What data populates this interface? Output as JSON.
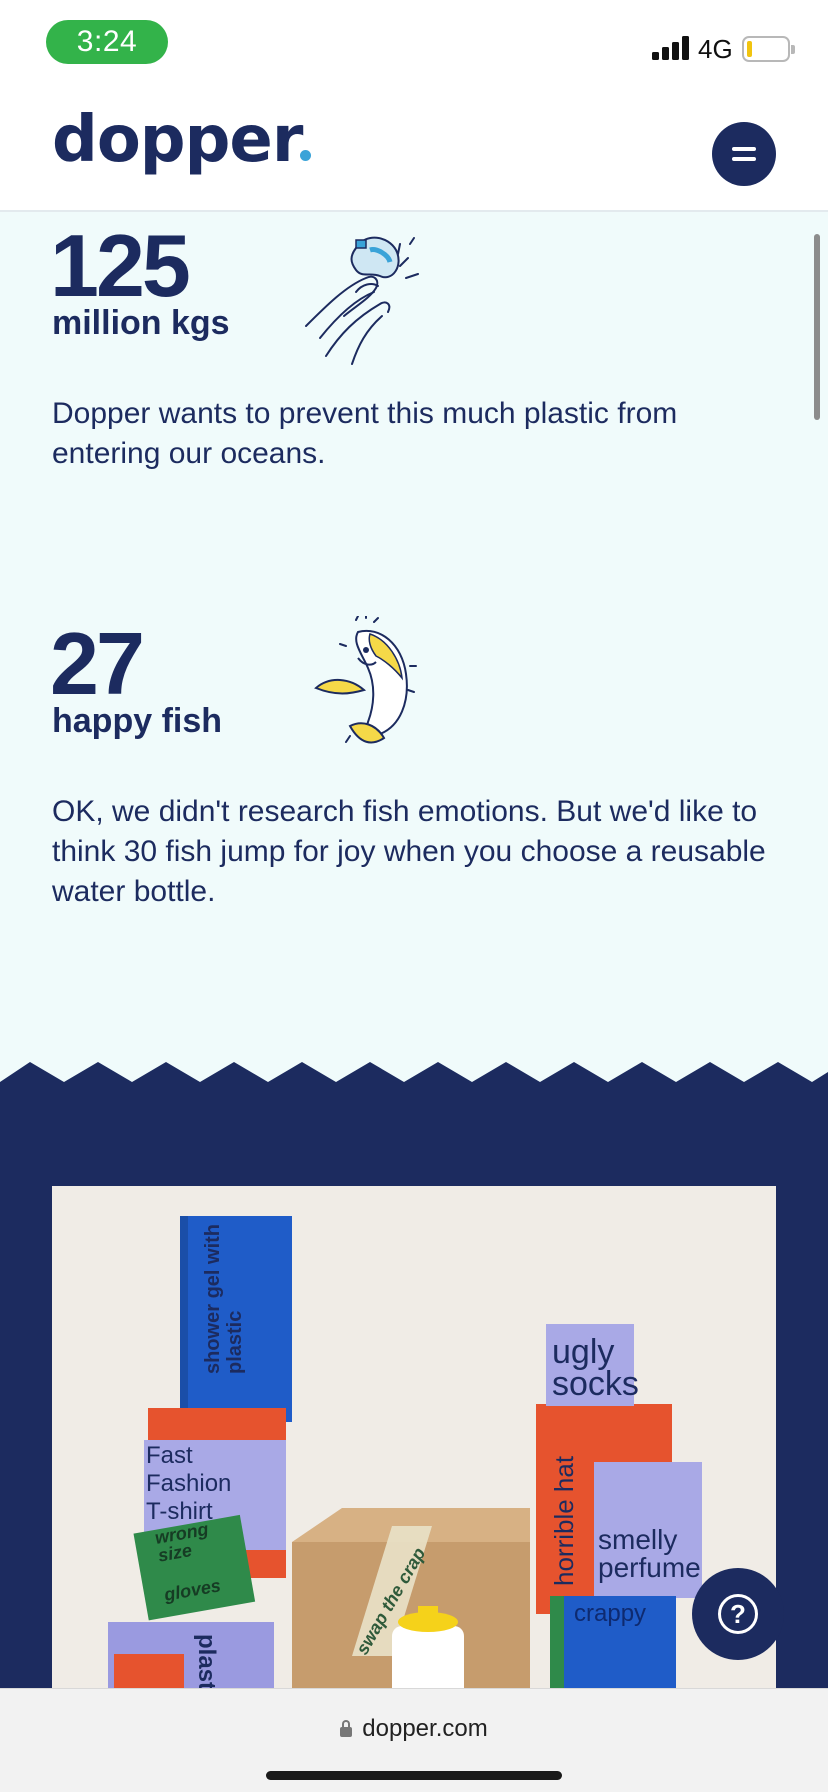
{
  "status_bar": {
    "time": "3:24",
    "network": "4G"
  },
  "header": {
    "logo_text": "dopper"
  },
  "stats": [
    {
      "number": "125",
      "unit": "million kgs",
      "text": "Dopper wants to prevent this much plastic from entering our oceans."
    },
    {
      "number": "27",
      "unit": "happy fish",
      "text": "OK, we didn't research fish emotions. But we'd like to think 30 fish jump for joy when you choose a reusable water bottle."
    }
  ],
  "photo": {
    "blocks": {
      "shower_gel": "shower gel with plastic",
      "fast_fashion": "Fast Fashion T-shirt",
      "wrong_size": "wrong size",
      "gloves": "gloves",
      "ugly_socks": "ugly socks",
      "horrible_hat": "horrible hat",
      "smelly_perfume": "smelly perfume",
      "crappy": "crappy",
      "swap": "swap the crap",
      "plastic": "plastic"
    }
  },
  "browser": {
    "url": "dopper.com"
  },
  "colors": {
    "navy": "#1c2b5f",
    "mint": "#f0fbfb",
    "accent_blue": "#3aa3d8",
    "time_green": "#33b34a"
  }
}
